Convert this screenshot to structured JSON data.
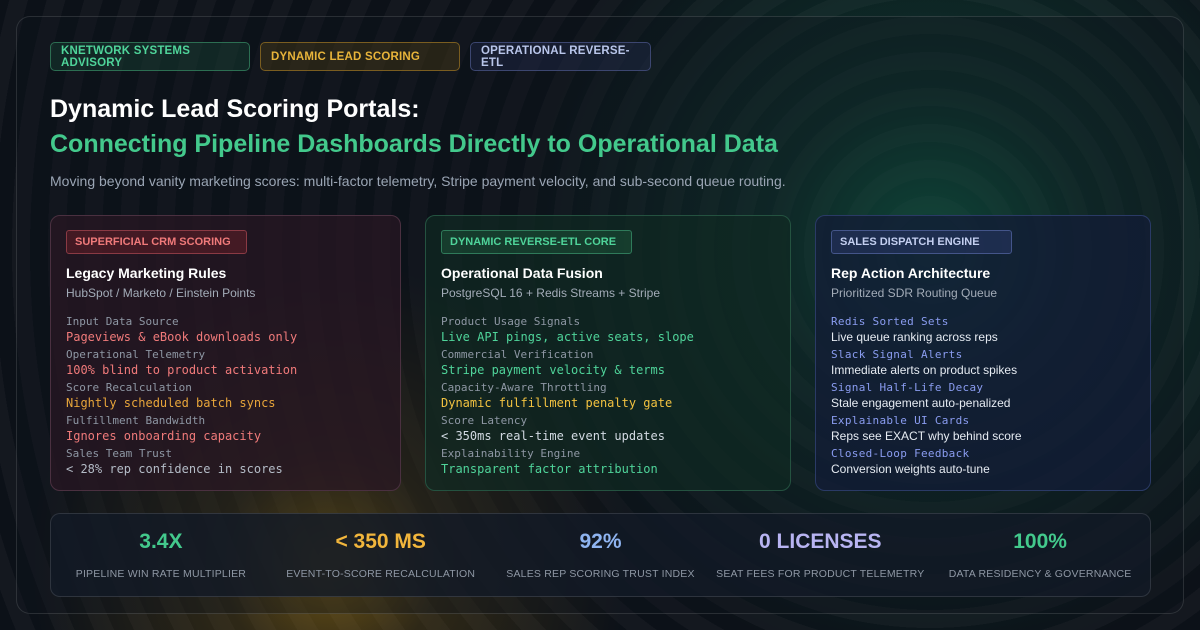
{
  "badges": [
    {
      "label": "KNETWORK SYSTEMS ADVISORY"
    },
    {
      "label": "DYNAMIC LEAD SCORING"
    },
    {
      "label": "OPERATIONAL REVERSE-ETL"
    }
  ],
  "header": {
    "title_line1": "Dynamic Lead Scoring Portals:",
    "title_line2": "Connecting Pipeline Dashboards Directly to Operational Data",
    "subtitle": "Moving beyond vanity marketing scores: multi-factor telemetry, Stripe payment velocity, and sub-second queue routing."
  },
  "cards": [
    {
      "tag": "SUPERFICIAL CRM SCORING",
      "title": "Legacy Marketing Rules",
      "subtitle": "HubSpot / Marketo / Einstein Points",
      "rows": [
        {
          "label": "Input Data Source",
          "value": "Pageviews & eBook downloads only"
        },
        {
          "label": "Operational Telemetry",
          "value": "100% blind to product activation"
        },
        {
          "label": "Score Recalculation",
          "value": "Nightly scheduled batch syncs"
        },
        {
          "label": "Fulfillment Bandwidth",
          "value": "Ignores onboarding capacity"
        },
        {
          "label": "Sales Team Trust",
          "value": "< 28% rep confidence in scores"
        }
      ]
    },
    {
      "tag": "DYNAMIC REVERSE-ETL CORE",
      "title": "Operational Data Fusion",
      "subtitle": "PostgreSQL 16 + Redis Streams + Stripe",
      "rows": [
        {
          "label": "Product Usage Signals",
          "value": "Live API pings, active seats, slope"
        },
        {
          "label": "Commercial Verification",
          "value": "Stripe payment velocity & terms"
        },
        {
          "label": "Capacity-Aware Throttling",
          "value": "Dynamic fulfillment penalty gate"
        },
        {
          "label": "Score Latency",
          "value": "< 350ms real-time event updates"
        },
        {
          "label": "Explainability Engine",
          "value": "Transparent factor attribution"
        }
      ]
    },
    {
      "tag": "SALES DISPATCH ENGINE",
      "title": "Rep Action Architecture",
      "subtitle": "Prioritized SDR Routing Queue",
      "rows": [
        {
          "label": "Redis Sorted Sets",
          "value": "Live queue ranking across reps"
        },
        {
          "label": "Slack Signal Alerts",
          "value": "Immediate alerts on product spikes"
        },
        {
          "label": "Signal Half-Life Decay",
          "value": "Stale engagement auto-penalized"
        },
        {
          "label": "Explainable UI Cards",
          "value": "Reps see EXACT why behind score"
        },
        {
          "label": "Closed-Loop Feedback",
          "value": "Conversion weights auto-tune"
        }
      ]
    }
  ],
  "stats": [
    {
      "value": "3.4X",
      "label": "PIPELINE WIN RATE MULTIPLIER",
      "color": "#43c98c"
    },
    {
      "value": "< 350 MS",
      "label": "EVENT-TO-SCORE RECALCULATION",
      "color": "#f2b63c"
    },
    {
      "value": "92%",
      "label": "SALES REP SCORING TRUST INDEX",
      "color": "#8fb4f0"
    },
    {
      "value": "0 LICENSES",
      "label": "SEAT FEES FOR PRODUCT TELEMETRY",
      "color": "#b8b4f2"
    },
    {
      "value": "100%",
      "label": "DATA RESIDENCY & GOVERNANCE",
      "color": "#43c98c"
    }
  ]
}
